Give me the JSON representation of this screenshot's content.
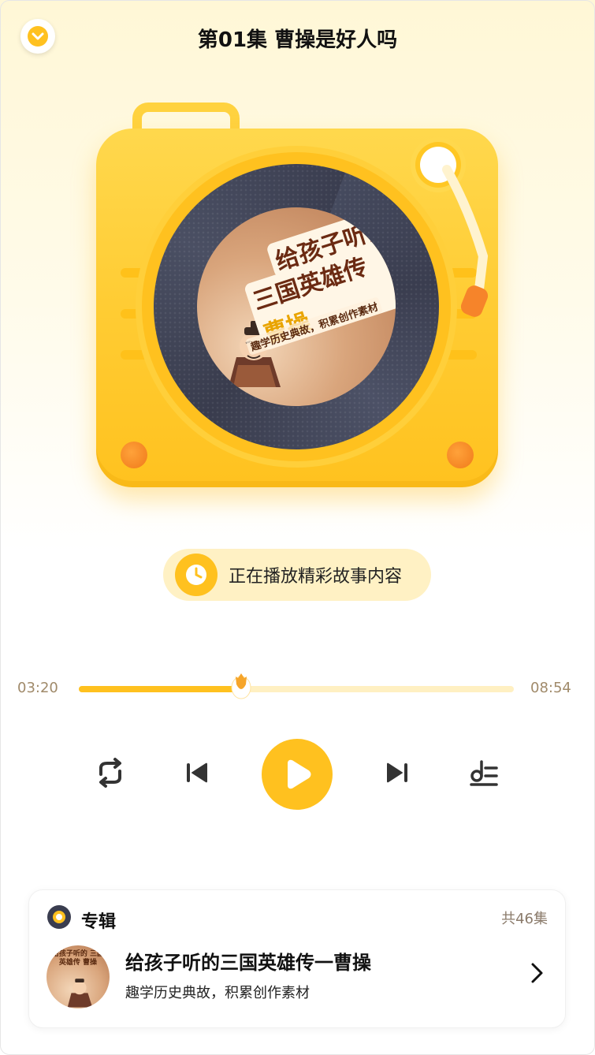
{
  "header": {
    "title": "第01集 曹操是好人吗",
    "collapse_icon": "chevron-down-icon"
  },
  "cover": {
    "title_line1": "给孩子听的",
    "title_line2": "三国英雄传",
    "title_highlight": "曹操",
    "subtitle": "趣学历史典故，积累创作素材"
  },
  "status": {
    "text": "正在播放精彩故事内容",
    "icon": "clock-icon"
  },
  "progress": {
    "current": "03:20",
    "total": "08:54",
    "fraction": 0.374
  },
  "controls": {
    "loop_icon": "loop-icon",
    "prev_icon": "skip-previous-icon",
    "play_icon": "play-icon",
    "next_icon": "skip-next-icon",
    "playlist_icon": "playlist-icon"
  },
  "album": {
    "label": "专辑",
    "count": "共46集",
    "name": "给孩子听的三国英雄传一曹操",
    "description": "趣学历史典故，积累创作素材",
    "thumb_text": "给孩子听的 三国英雄传 曹操"
  },
  "colors": {
    "accent": "#ffc11f",
    "accent_light": "#fff1c4",
    "orange": "#f6842a",
    "disc": "#3e4153",
    "time_text": "#a08a6a"
  }
}
